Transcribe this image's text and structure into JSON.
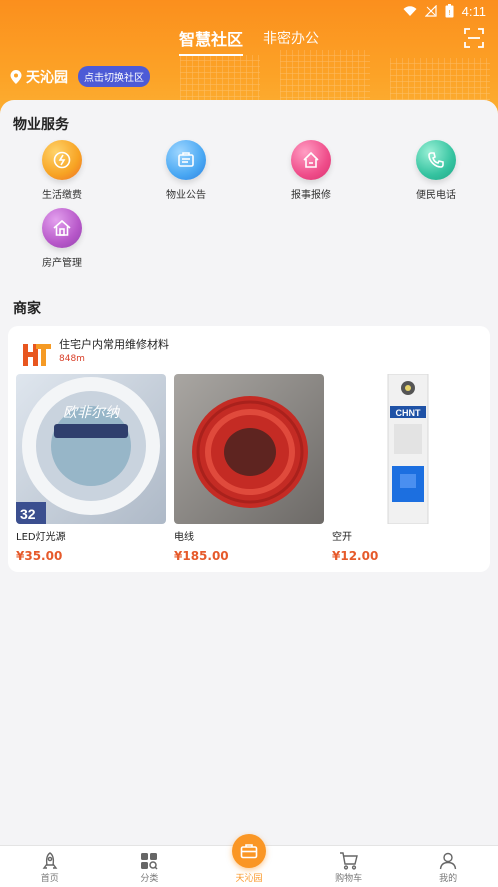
{
  "status": {
    "time": "4:11"
  },
  "header": {
    "tab_active": "智慧社区",
    "tab_other": "非密办公",
    "location": "天沁园",
    "switch_label": "点击切换社区"
  },
  "property": {
    "title": "物业服务",
    "items": [
      {
        "label": "生活缴费",
        "icon": "payment-icon",
        "color": "#f7a323"
      },
      {
        "label": "物业公告",
        "icon": "notice-icon",
        "color": "#4aa8f3"
      },
      {
        "label": "报事报修",
        "icon": "repair-icon",
        "color": "#ef4d8a"
      },
      {
        "label": "便民电话",
        "icon": "phone-icon",
        "color": "#35c3a0"
      },
      {
        "label": "房产管理",
        "icon": "house-icon",
        "color": "#b758c9"
      }
    ]
  },
  "merchants": {
    "title": "商家",
    "store_name": "住宅户内常用维修材料",
    "distance": "848m",
    "products": [
      {
        "name": "LED灯光源",
        "price": "¥35.00",
        "img_text": "欧非尔纳",
        "badge": "32"
      },
      {
        "name": "电线",
        "price": "¥185.00"
      },
      {
        "name": "空开",
        "price": "¥12.00",
        "brand": "CHNT"
      }
    ]
  },
  "nav": {
    "items": [
      {
        "label": "首页"
      },
      {
        "label": "分类"
      },
      {
        "label": "天沁园"
      },
      {
        "label": "购物车"
      },
      {
        "label": "我的"
      }
    ],
    "accent": "#fa9624"
  }
}
